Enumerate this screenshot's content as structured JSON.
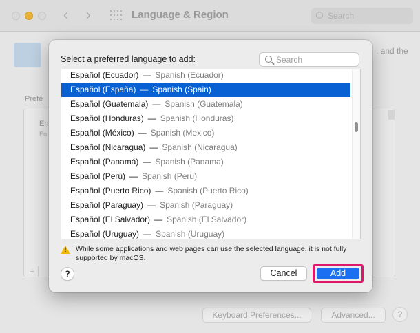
{
  "window": {
    "title": "Language & Region",
    "search_placeholder": "Search",
    "description_tail": ", and the",
    "preferred_label": "Prefe",
    "preferred_item": "En",
    "preferred_item_sub": "En",
    "add_remove": "+",
    "keyboard_button": "Keyboard Preferences...",
    "advanced_button": "Advanced...",
    "help": "?"
  },
  "sheet": {
    "prompt": "Select a preferred language to add:",
    "search_placeholder": "Search",
    "languages": [
      {
        "native": "Español (Ecuador)",
        "english": "Spanish (Ecuador)",
        "selected": false
      },
      {
        "native": "Español (España)",
        "english": "Spanish (Spain)",
        "selected": true
      },
      {
        "native": "Español (Guatemala)",
        "english": "Spanish (Guatemala)",
        "selected": false
      },
      {
        "native": "Español (Honduras)",
        "english": "Spanish (Honduras)",
        "selected": false
      },
      {
        "native": "Español (México)",
        "english": "Spanish (Mexico)",
        "selected": false
      },
      {
        "native": "Español (Nicaragua)",
        "english": "Spanish (Nicaragua)",
        "selected": false
      },
      {
        "native": "Español (Panamá)",
        "english": "Spanish (Panama)",
        "selected": false
      },
      {
        "native": "Español (Perú)",
        "english": "Spanish (Peru)",
        "selected": false
      },
      {
        "native": "Español (Puerto Rico)",
        "english": "Spanish (Puerto Rico)",
        "selected": false
      },
      {
        "native": "Español (Paraguay)",
        "english": "Spanish (Paraguay)",
        "selected": false
      },
      {
        "native": "Español (El Salvador)",
        "english": "Spanish (El Salvador)",
        "selected": false
      },
      {
        "native": "Español (Uruguay)",
        "english": "Spanish (Uruguay)",
        "selected": false
      }
    ],
    "separator": "—",
    "warning": "While some applications and web pages can use the selected language, it is not fully supported by macOS.",
    "help": "?",
    "cancel": "Cancel",
    "add": "Add"
  },
  "icons": {
    "back": "chevron-left-icon",
    "forward": "chevron-right-icon",
    "grid": "show-all-grid-icon",
    "search": "search-icon",
    "warning": "warning-triangle-icon",
    "globe": "globe-flag-icon"
  },
  "colors": {
    "selection": "#0960d3",
    "primary_button": "#1d6ff2",
    "highlight_outline": "#e0166b",
    "warning": "#f2b705"
  }
}
